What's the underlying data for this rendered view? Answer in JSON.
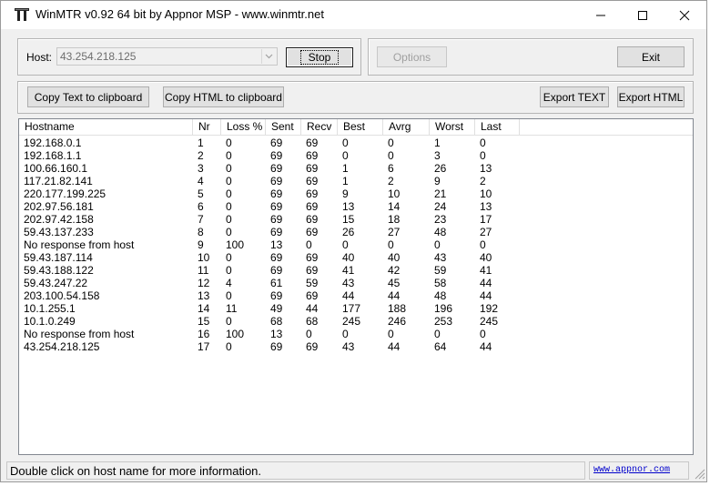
{
  "window": {
    "title": "WinMTR v0.92 64 bit by Appnor MSP - www.winmtr.net"
  },
  "host_section": {
    "label": "Host:",
    "value": "43.254.218.125",
    "stop_label": "Stop",
    "options_label": "Options",
    "exit_label": "Exit"
  },
  "export_section": {
    "copy_text_label": "Copy Text to clipboard",
    "copy_html_label": "Copy HTML to clipboard",
    "export_text_label": "Export TEXT",
    "export_html_label": "Export HTML"
  },
  "table": {
    "columns": [
      "Hostname",
      "Nr",
      "Loss %",
      "Sent",
      "Recv",
      "Best",
      "Avrg",
      "Worst",
      "Last"
    ],
    "rows": [
      [
        "192.168.0.1",
        "1",
        "0",
        "69",
        "69",
        "0",
        "0",
        "1",
        "0"
      ],
      [
        "192.168.1.1",
        "2",
        "0",
        "69",
        "69",
        "0",
        "0",
        "3",
        "0"
      ],
      [
        "100.66.160.1",
        "3",
        "0",
        "69",
        "69",
        "1",
        "6",
        "26",
        "13"
      ],
      [
        "117.21.82.141",
        "4",
        "0",
        "69",
        "69",
        "1",
        "2",
        "9",
        "2"
      ],
      [
        "220.177.199.225",
        "5",
        "0",
        "69",
        "69",
        "9",
        "10",
        "21",
        "10"
      ],
      [
        "202.97.56.181",
        "6",
        "0",
        "69",
        "69",
        "13",
        "14",
        "24",
        "13"
      ],
      [
        "202.97.42.158",
        "7",
        "0",
        "69",
        "69",
        "15",
        "18",
        "23",
        "17"
      ],
      [
        "59.43.137.233",
        "8",
        "0",
        "69",
        "69",
        "26",
        "27",
        "48",
        "27"
      ],
      [
        "No response from host",
        "9",
        "100",
        "13",
        "0",
        "0",
        "0",
        "0",
        "0"
      ],
      [
        "59.43.187.114",
        "10",
        "0",
        "69",
        "69",
        "40",
        "40",
        "43",
        "40"
      ],
      [
        "59.43.188.122",
        "11",
        "0",
        "69",
        "69",
        "41",
        "42",
        "59",
        "41"
      ],
      [
        "59.43.247.22",
        "12",
        "4",
        "61",
        "59",
        "43",
        "45",
        "58",
        "44"
      ],
      [
        "203.100.54.158",
        "13",
        "0",
        "69",
        "69",
        "44",
        "44",
        "48",
        "44"
      ],
      [
        "10.1.255.1",
        "14",
        "11",
        "49",
        "44",
        "177",
        "188",
        "196",
        "192"
      ],
      [
        "10.1.0.249",
        "15",
        "0",
        "68",
        "68",
        "245",
        "246",
        "253",
        "245"
      ],
      [
        "No response from host",
        "16",
        "100",
        "13",
        "0",
        "0",
        "0",
        "0",
        "0"
      ],
      [
        "43.254.218.125",
        "17",
        "0",
        "69",
        "69",
        "43",
        "44",
        "64",
        "44"
      ]
    ]
  },
  "status_bar": {
    "message": "Double click on host name for more information.",
    "link": "www.appnor.com"
  },
  "icons": {
    "app": "winmtr-app-icon",
    "minimize": "minimize-icon",
    "maximize": "maximize-icon",
    "close": "close-icon",
    "dropdown": "chevron-down-icon",
    "grip": "resize-grip-icon"
  }
}
